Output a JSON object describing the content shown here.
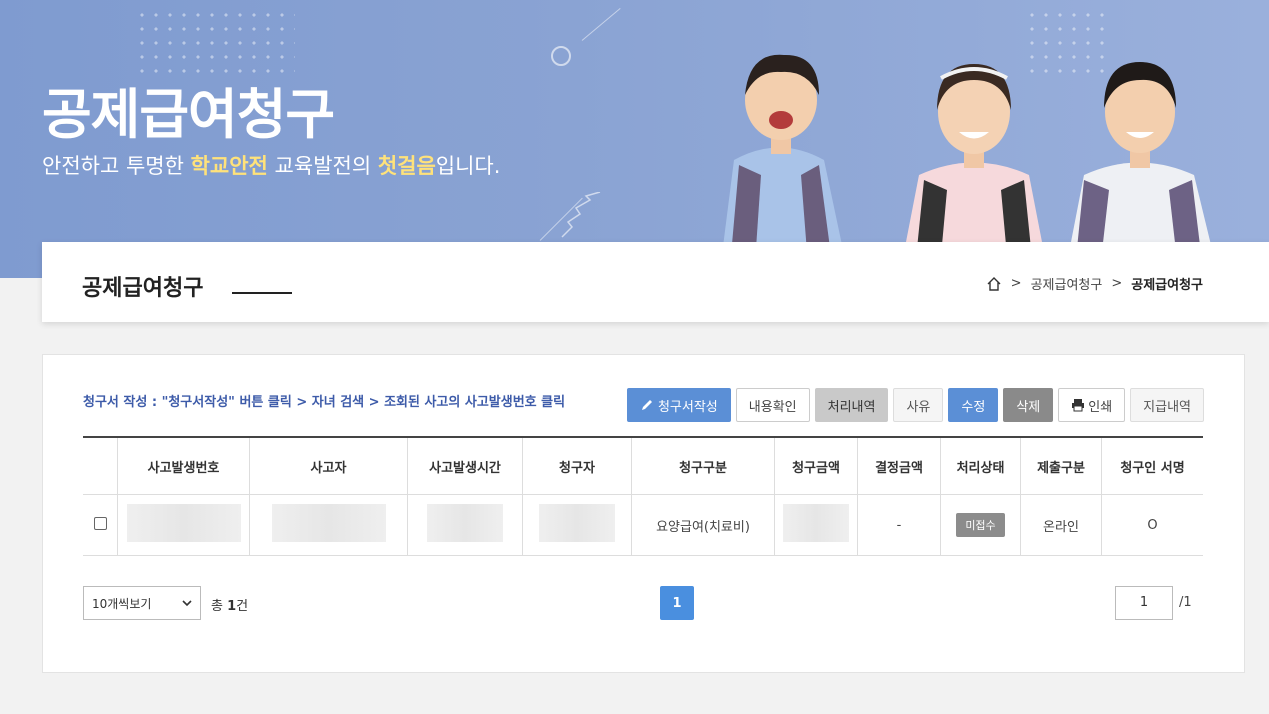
{
  "hero": {
    "title": "공제급여청구",
    "subtitle_pre": "안전하고 투명한 ",
    "subtitle_hl1": "학교안전",
    "subtitle_mid": " 교육발전의 ",
    "subtitle_hl2": "첫걸음",
    "subtitle_post": "입니다."
  },
  "header": {
    "page_title": "공제급여청구",
    "breadcrumb": [
      ">",
      "공제급여청구",
      ">",
      "공제급여청구"
    ]
  },
  "guide_text": "청구서 작성 : \"청구서작성\" 버튼 클릭 > 자녀 검색 > 조회된 사고의 사고발생번호 클릭",
  "toolbar": {
    "write": "청구서작성",
    "view": "내용확인",
    "history": "처리내역",
    "reason": "사유",
    "edit": "수정",
    "delete": "삭제",
    "print": "인쇄",
    "payment": "지급내역"
  },
  "table": {
    "columns": [
      "",
      "사고발생번호",
      "사고자",
      "사고발생시간",
      "청구자",
      "청구구분",
      "청구금액",
      "결정금액",
      "처리상태",
      "제출구분",
      "청구인 서명"
    ],
    "rows": [
      {
        "accident_no": "",
        "victim": "",
        "time": "",
        "claimant": "",
        "type": "요양급여(치료비)",
        "amount": "",
        "decided": "-",
        "status": "미접수",
        "submit": "온라인",
        "signature": "O"
      }
    ]
  },
  "footer": {
    "per_page": "10개씩보기",
    "total_pre": "총 ",
    "total_count": "1",
    "total_post": "건",
    "current_page": "1",
    "page_input": "1",
    "page_total": "/1"
  },
  "colors": {
    "accent": "#5b8fd6",
    "hero": "#8aa3d3",
    "highlight": "#ffe27a"
  }
}
